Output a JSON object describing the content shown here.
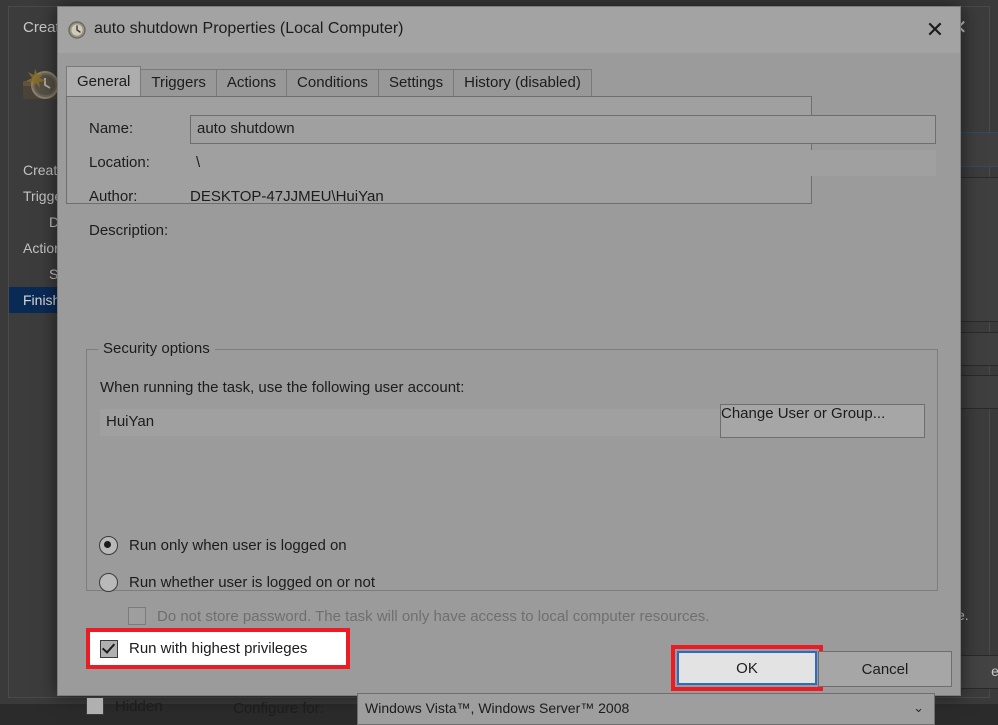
{
  "background_window": {
    "title": "Create Basic Task Wizard",
    "close_label": "✕",
    "banner_icon": "task-clock-icon",
    "steps": [
      {
        "label": "Create a Basic Task",
        "sub": false,
        "selected": false
      },
      {
        "label": "Trigger",
        "sub": false,
        "selected": false
      },
      {
        "label": "Daily",
        "sub": true,
        "selected": false
      },
      {
        "label": "Action",
        "sub": false,
        "selected": false
      },
      {
        "label": "Start a Program",
        "sub": true,
        "selected": false
      },
      {
        "label": "Finish",
        "sub": false,
        "selected": true
      }
    ],
    "tail_text": "e.",
    "cancel_label": "el"
  },
  "dialog": {
    "icon": "task-clock-icon",
    "title": "auto shutdown Properties (Local Computer)",
    "close_label": "✕",
    "tabs": [
      {
        "label": "General",
        "active": true
      },
      {
        "label": "Triggers",
        "active": false
      },
      {
        "label": "Actions",
        "active": false
      },
      {
        "label": "Conditions",
        "active": false
      },
      {
        "label": "Settings",
        "active": false
      },
      {
        "label": "History (disabled)",
        "active": false
      }
    ],
    "general": {
      "name_label": "Name:",
      "name_value": "auto shutdown",
      "location_label": "Location:",
      "location_value": "\\",
      "author_label": "Author:",
      "author_value": "DESKTOP-47JJMEU\\HuiYan",
      "description_label": "Description:",
      "description_value": "",
      "security": {
        "group_title": "Security options",
        "account_prompt": "When running the task, use the following user account:",
        "account_value": "HuiYan",
        "change_user_button": "Change User or Group...",
        "run_logged_on_label": "Run only when user is logged on",
        "run_logged_on_checked": true,
        "run_whether_label": "Run whether user is logged on or not",
        "run_whether_checked": false,
        "do_not_store_label": "Do not store password.  The task will only have access to local computer resources.",
        "do_not_store_checked": false,
        "do_not_store_disabled": true,
        "highest_privileges_label": "Run with highest privileges",
        "highest_privileges_checked": true
      },
      "hidden_label": "Hidden",
      "hidden_checked": false,
      "configure_for_label": "Configure for:",
      "configure_for_value": "Windows Vista™, Windows Server™ 2008",
      "configure_for_caret": "⌄"
    },
    "footer": {
      "ok_label": "OK",
      "cancel_label": "Cancel"
    }
  },
  "annotations": {
    "highlight_color": "#ec1c24",
    "focus_color": "#2a6cc4",
    "targets": [
      "highest-privileges-checkbox",
      "ok-button"
    ]
  }
}
